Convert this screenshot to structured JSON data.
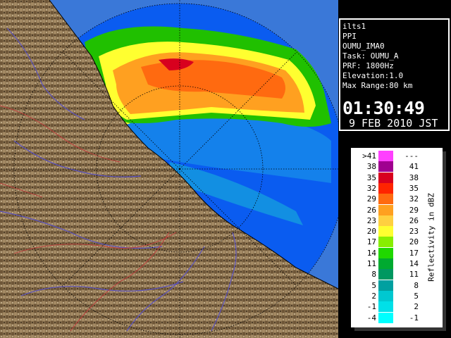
{
  "info_panel": {
    "lines": [
      "ilts1",
      "PPI",
      "OUMU_IMA0",
      "Task: OUMU_A",
      "PRF: 1800Hz",
      "Elevation:1.0",
      "Max Range:80 km"
    ],
    "time": "01:30:49",
    "date": "9 FEB 2010 JST"
  },
  "legend": {
    "unit": "Reflectivity in dBZ",
    "rows": [
      {
        "left": ">41",
        "right": "---",
        "color": "#ff40ff"
      },
      {
        "left": "38",
        "right": "41",
        "color": "#a00090"
      },
      {
        "left": "35",
        "right": "38",
        "color": "#d8001e"
      },
      {
        "left": "32",
        "right": "35",
        "color": "#ff2400"
      },
      {
        "left": "29",
        "right": "32",
        "color": "#ff6a10"
      },
      {
        "left": "26",
        "right": "29",
        "color": "#ffa020"
      },
      {
        "left": "23",
        "right": "26",
        "color": "#ffd040"
      },
      {
        "left": "20",
        "right": "23",
        "color": "#ffff30"
      },
      {
        "left": "17",
        "right": "20",
        "color": "#88ee00"
      },
      {
        "left": "14",
        "right": "17",
        "color": "#20d800"
      },
      {
        "left": "11",
        "right": "14",
        "color": "#00aa30"
      },
      {
        "left": "8",
        "right": "11",
        "color": "#009860"
      },
      {
        "left": "5",
        "right": "8",
        "color": "#00a0a0"
      },
      {
        "left": "2",
        "right": "5",
        "color": "#00c8d0"
      },
      {
        "left": "-1",
        "right": "2",
        "color": "#00e0e8"
      },
      {
        "left": "-4",
        "right": "-1",
        "color": "#00ffff"
      }
    ]
  },
  "map_colors": {
    "ocean_outer": "#3a78d8",
    "ocean_inner": "#0a5cf0",
    "land": "#8a7250",
    "rivers": "#5a52c0",
    "roads": "#c03a3a"
  }
}
